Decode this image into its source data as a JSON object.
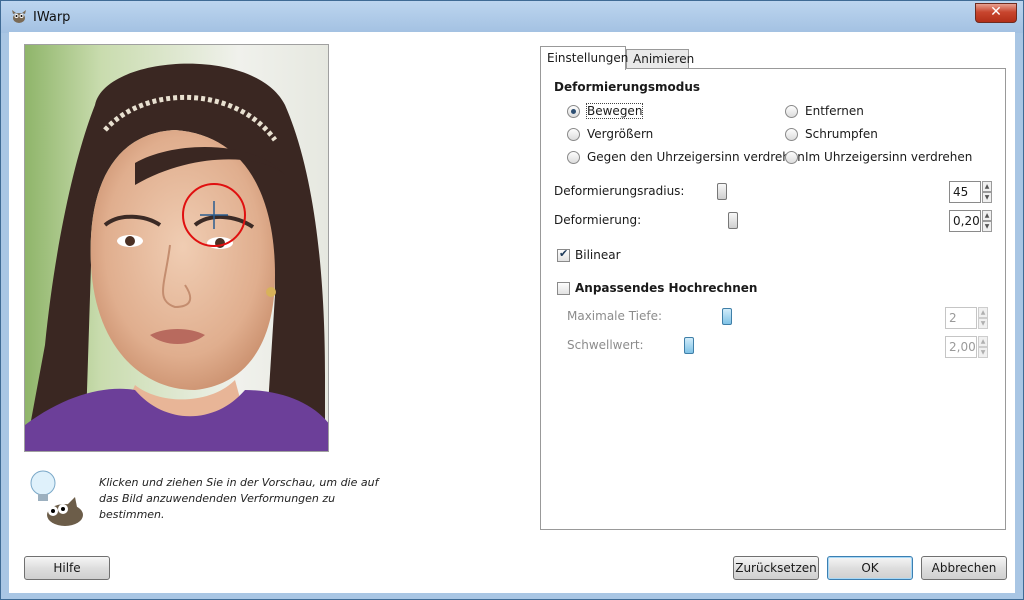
{
  "window": {
    "title": "IWarp",
    "close_symbol": "✕"
  },
  "preview": {
    "image": "portrait-photo"
  },
  "hint": {
    "text": "Klicken und ziehen Sie in der Vorschau, um die auf das Bild anzuwendenden Verformungen zu bestimmen.",
    "icon": "lightbulb-wilber-icon"
  },
  "tabs": [
    {
      "label": "Einstellungen",
      "active": true
    },
    {
      "label": "Animieren",
      "active": false
    }
  ],
  "settings": {
    "mode_title": "Deformierungsmodus",
    "modes": [
      {
        "label": "Bewegen",
        "checked": true
      },
      {
        "label": "Vergrößern",
        "checked": false
      },
      {
        "label": "Gegen den Uhrzeigersinn verdrehen",
        "checked": false
      },
      {
        "label": "Entfernen",
        "checked": false
      },
      {
        "label": "Schrumpfen",
        "checked": false
      },
      {
        "label": "Im Uhrzeigersinn verdrehen",
        "checked": false
      }
    ],
    "radius": {
      "label": "Deformierungsradius:",
      "value": "45",
      "min": 5,
      "max": 255,
      "level": 45
    },
    "amount": {
      "label": "Deformierung:",
      "value": "0,20",
      "min": 0,
      "max": 1,
      "level": 0.2
    },
    "bilinear": {
      "label": "Bilinear",
      "checked": true
    },
    "supersample": {
      "label": "Anpassendes Hochrechnen",
      "checked": false
    },
    "max_depth": {
      "label": "Maximale Tiefe:",
      "value": "2",
      "min": 1,
      "max": 5,
      "level": 2
    },
    "threshold": {
      "label": "Schwellwert:",
      "value": "2,00",
      "min": 1,
      "max": 10,
      "level": 2
    }
  },
  "buttons": {
    "help": "Hilfe",
    "reset": "Zurücksetzen",
    "ok": "OK",
    "cancel": "Abbrechen"
  }
}
